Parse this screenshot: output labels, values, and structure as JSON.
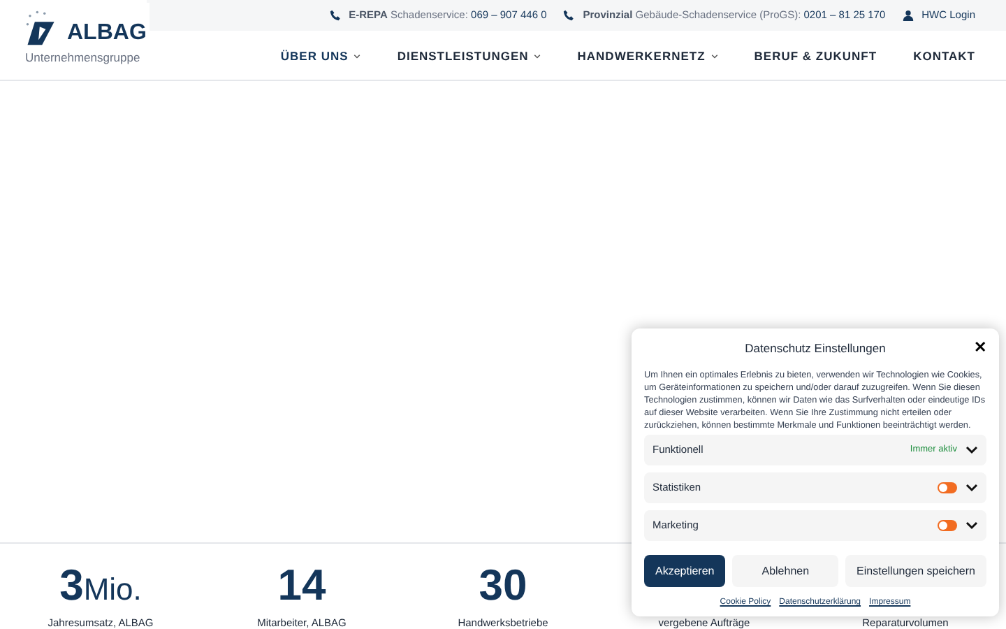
{
  "logo": {
    "name": "ALBAG",
    "subtitle": "Unternehmensgruppe"
  },
  "topbar": [
    {
      "kind": "phone",
      "bold": "E-REPA",
      "label": "Schadenservice:",
      "number": "069 – 907 446 0"
    },
    {
      "kind": "phone",
      "bold": "Provinzial",
      "label": "Gebäude-Schadenservice (ProGS):",
      "number": "0201 – 81 25 170"
    },
    {
      "kind": "user",
      "number": "HWC Login"
    }
  ],
  "nav": [
    {
      "label": "ÜBER UNS",
      "dropdown": true,
      "selected": true
    },
    {
      "label": "DIENSTLEISTUNGEN",
      "dropdown": true,
      "selected": false
    },
    {
      "label": "HANDWERKERNETZ",
      "dropdown": true,
      "selected": false
    },
    {
      "label": "BERUF & ZUKUNFT",
      "dropdown": false,
      "selected": false
    },
    {
      "label": "KONTAKT",
      "dropdown": false,
      "selected": false
    }
  ],
  "stats": [
    {
      "number": "3",
      "unit": "Mio.",
      "label": "Jahresumsatz, ALBAG"
    },
    {
      "number": "14",
      "label": "Mitarbeiter, ALBAG"
    },
    {
      "number": "30",
      "label": "Handwerksbetriebe"
    },
    {
      "label": "vergebene Aufträge"
    },
    {
      "label": "Reparaturvolumen"
    }
  ],
  "cookie_dialog": {
    "title": "Datenschutz Einstellungen",
    "close": "✕",
    "text": "Um Ihnen ein optimales Erlebnis zu bieten, verwenden wir Technologien wie Cookies, um Geräteinformationen zu speichern und/oder darauf zuzugreifen. Wenn Sie diesen Technologien zustimmen, können wir Daten wie das Surfverhalten oder eindeutige IDs auf dieser Website verarbeiten. Wenn Sie Ihre Zustimmung nicht erteilen oder zurückziehen, können bestimmte Merkmale und Funktionen beeinträchtigt werden.",
    "categories": [
      {
        "kind": "always",
        "label": "Funktionell",
        "status": "Immer aktiv"
      },
      {
        "kind": "toggle",
        "label": "Statistiken",
        "checked": false
      },
      {
        "kind": "toggle",
        "label": "Marketing",
        "checked": false
      }
    ],
    "buttons": [
      {
        "label": "Akzeptieren",
        "primary": true
      },
      {
        "label": "Ablehnen",
        "primary": false
      },
      {
        "label": "Einstellungen speichern",
        "primary": false
      }
    ],
    "links": [
      "Cookie Policy",
      "Datenschutzerklärung",
      "Impressum"
    ]
  }
}
